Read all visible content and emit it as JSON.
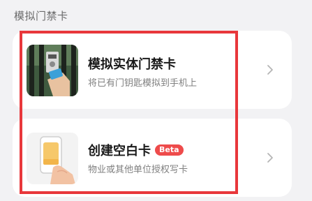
{
  "section": {
    "title": "模拟门禁卡"
  },
  "cards": [
    {
      "title": "模拟实体门禁卡",
      "subtitle": "将已有门钥匙模拟到手机上"
    },
    {
      "title": "创建空白卡",
      "badge": "Beta",
      "subtitle": "物业或其他单位授权写卡"
    }
  ],
  "colors": {
    "highlight": "#e8373b",
    "badge": "#ee4b4b",
    "card_bg": "#ffffff",
    "page_bg": "#f2f2f4"
  }
}
